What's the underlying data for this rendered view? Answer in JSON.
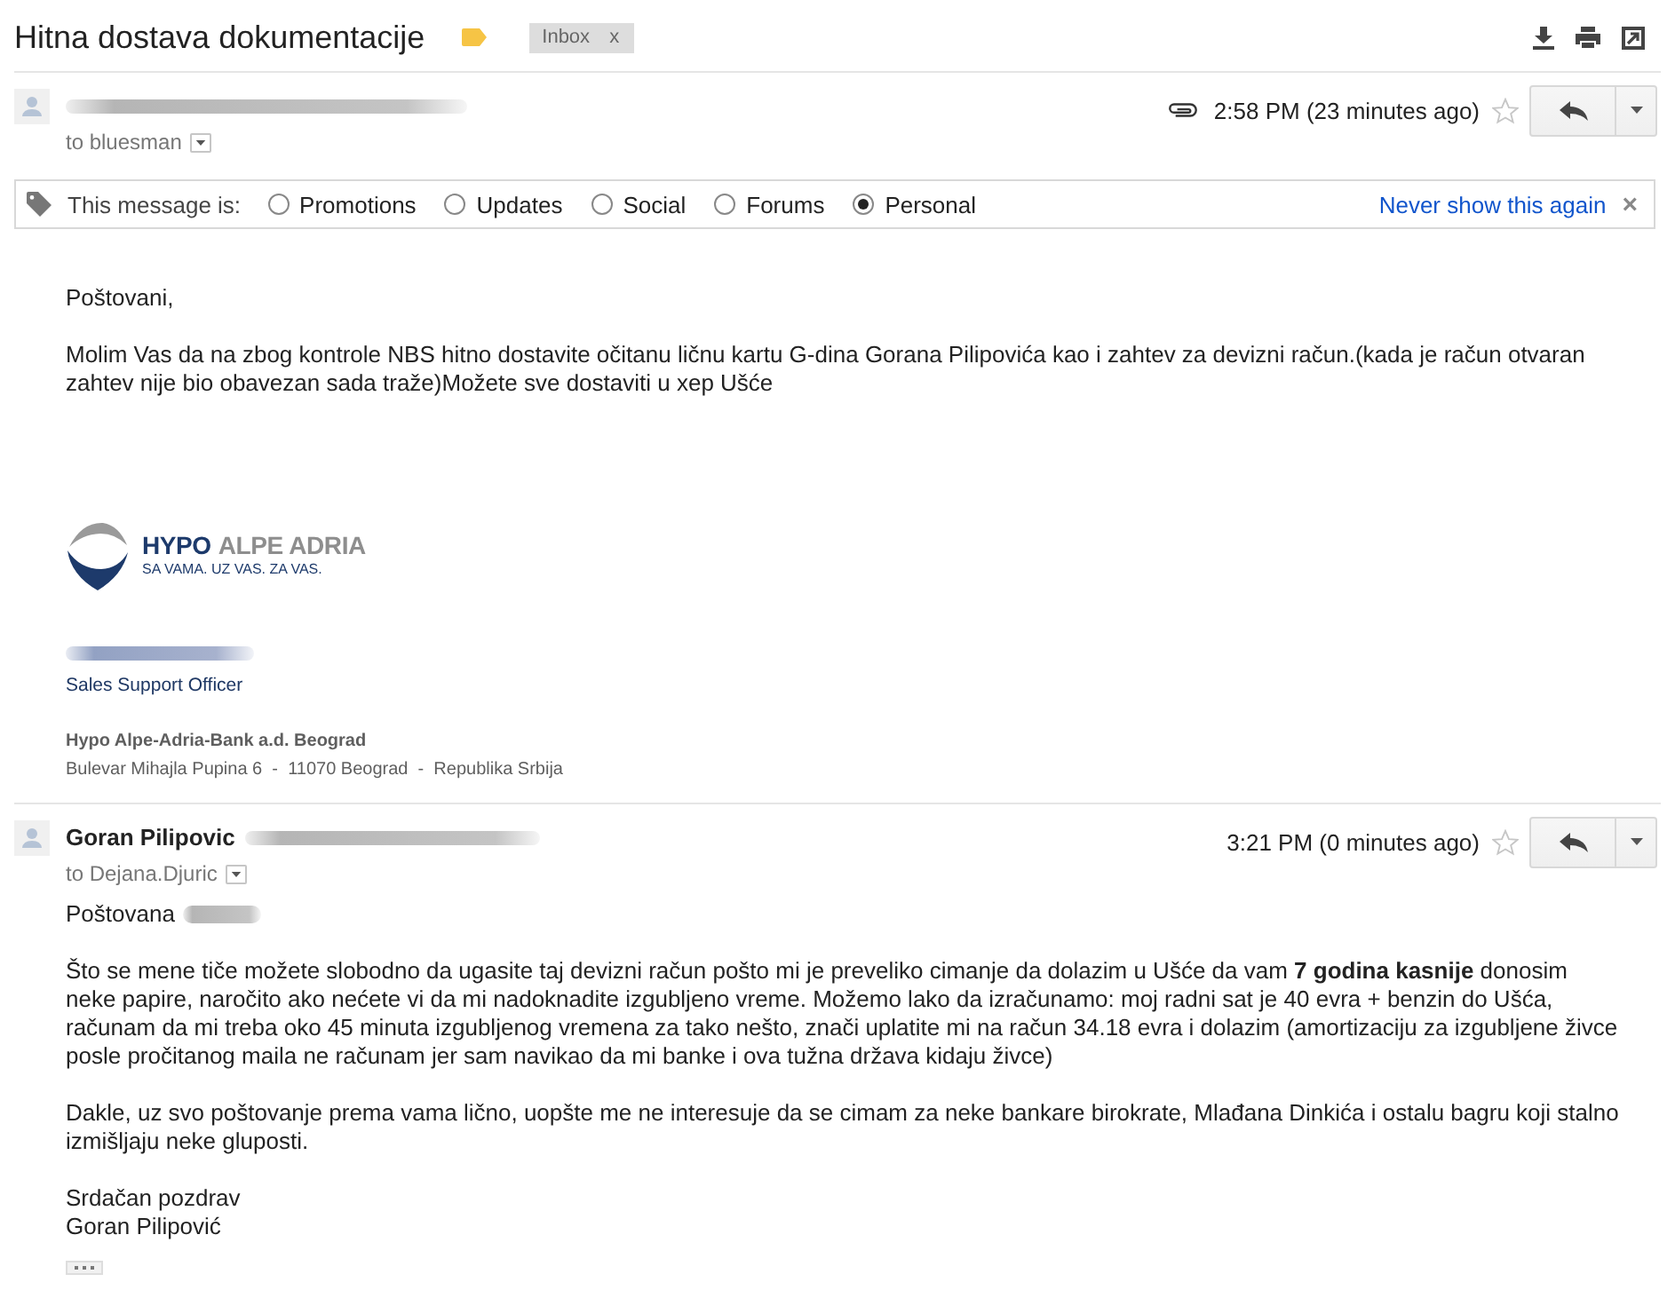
{
  "subject": {
    "title": "Hitna dostava dokumentacije",
    "labels": [
      {
        "name": "Inbox",
        "remove": "x"
      }
    ]
  },
  "messages": [
    {
      "recipient": "to bluesman",
      "attachment": true,
      "time": "2:58 PM (23 minutes ago)",
      "starred": false,
      "category_bar": {
        "prompt": "This message is:",
        "options": [
          {
            "label": "Promotions",
            "selected": false
          },
          {
            "label": "Updates",
            "selected": false
          },
          {
            "label": "Social",
            "selected": false
          },
          {
            "label": "Forums",
            "selected": false
          },
          {
            "label": "Personal",
            "selected": true
          }
        ],
        "dismiss": "Never show this again",
        "close": "×"
      },
      "body": [
        {
          "kind": "text",
          "lines": [
            "Poštovani,"
          ]
        },
        {
          "kind": "text",
          "lines": [
            "Molim Vas da na zbog kontrole NBS hitno dostavite očitanu ličnu kartu G-dina Gorana Pilipovića kao i zahtev za devizni račun.(kada je račun otvaran zahtev nije bio obavezan sada traže)Možete sve dostaviti u xep Ušće"
          ]
        }
      ],
      "signature": {
        "logo": {
          "primary": "HYPO",
          "secondary": "ALPE ADRIA",
          "tagline": "SA VAMA. UZ VAS. ZA VAS."
        },
        "title": "Sales Support Officer",
        "company": "Hypo Alpe-Adria-Bank a.d. Beograd",
        "address": "Bulevar Mihajla Pupina 6  -  11070 Beograd  -  Republika Srbija"
      }
    },
    {
      "sender_name": "Goran Pilipovic",
      "recipient": "to Dejana.Djuric",
      "attachment": false,
      "time": "3:21 PM (0 minutes ago)",
      "starred": false,
      "body": [
        {
          "kind": "greeting",
          "text": "Poštovana"
        },
        {
          "kind": "text",
          "lines": [
            "Što se mene tiče možete slobodno da ugasite taj devizni račun pošto mi je preveliko cimanje da dolazim u Ušće da vam **7 godina kasnije** donosim neke papire, naročito ako nećete vi da mi nadoknadite izgubljeno vreme. Možemo lako da izračunamo: moj radni sat je 40 evra + benzin do Ušća, računam da mi treba oko 45 minuta izgubljenog vremena za tako nešto, znači uplatite mi na račun 34.18 evra i dolazim (amortizaciju za izgubljene živce posle pročitanog maila ne računam jer sam navikao da mi banke i ova tužna država kidaju živce)"
          ]
        },
        {
          "kind": "text",
          "lines": [
            "Dakle, uz svo poštovanje prema vama lično, uopšte me ne interesuje da se cimam za neke bankare birokrate, Mlađana Dinkića i ostalu bagru koji stalno izmišljaju neke gluposti."
          ]
        },
        {
          "kind": "text",
          "lines": [
            "Srdačan pozdrav",
            "Goran Pilipović"
          ]
        }
      ],
      "trimmed_content": true
    }
  ]
}
